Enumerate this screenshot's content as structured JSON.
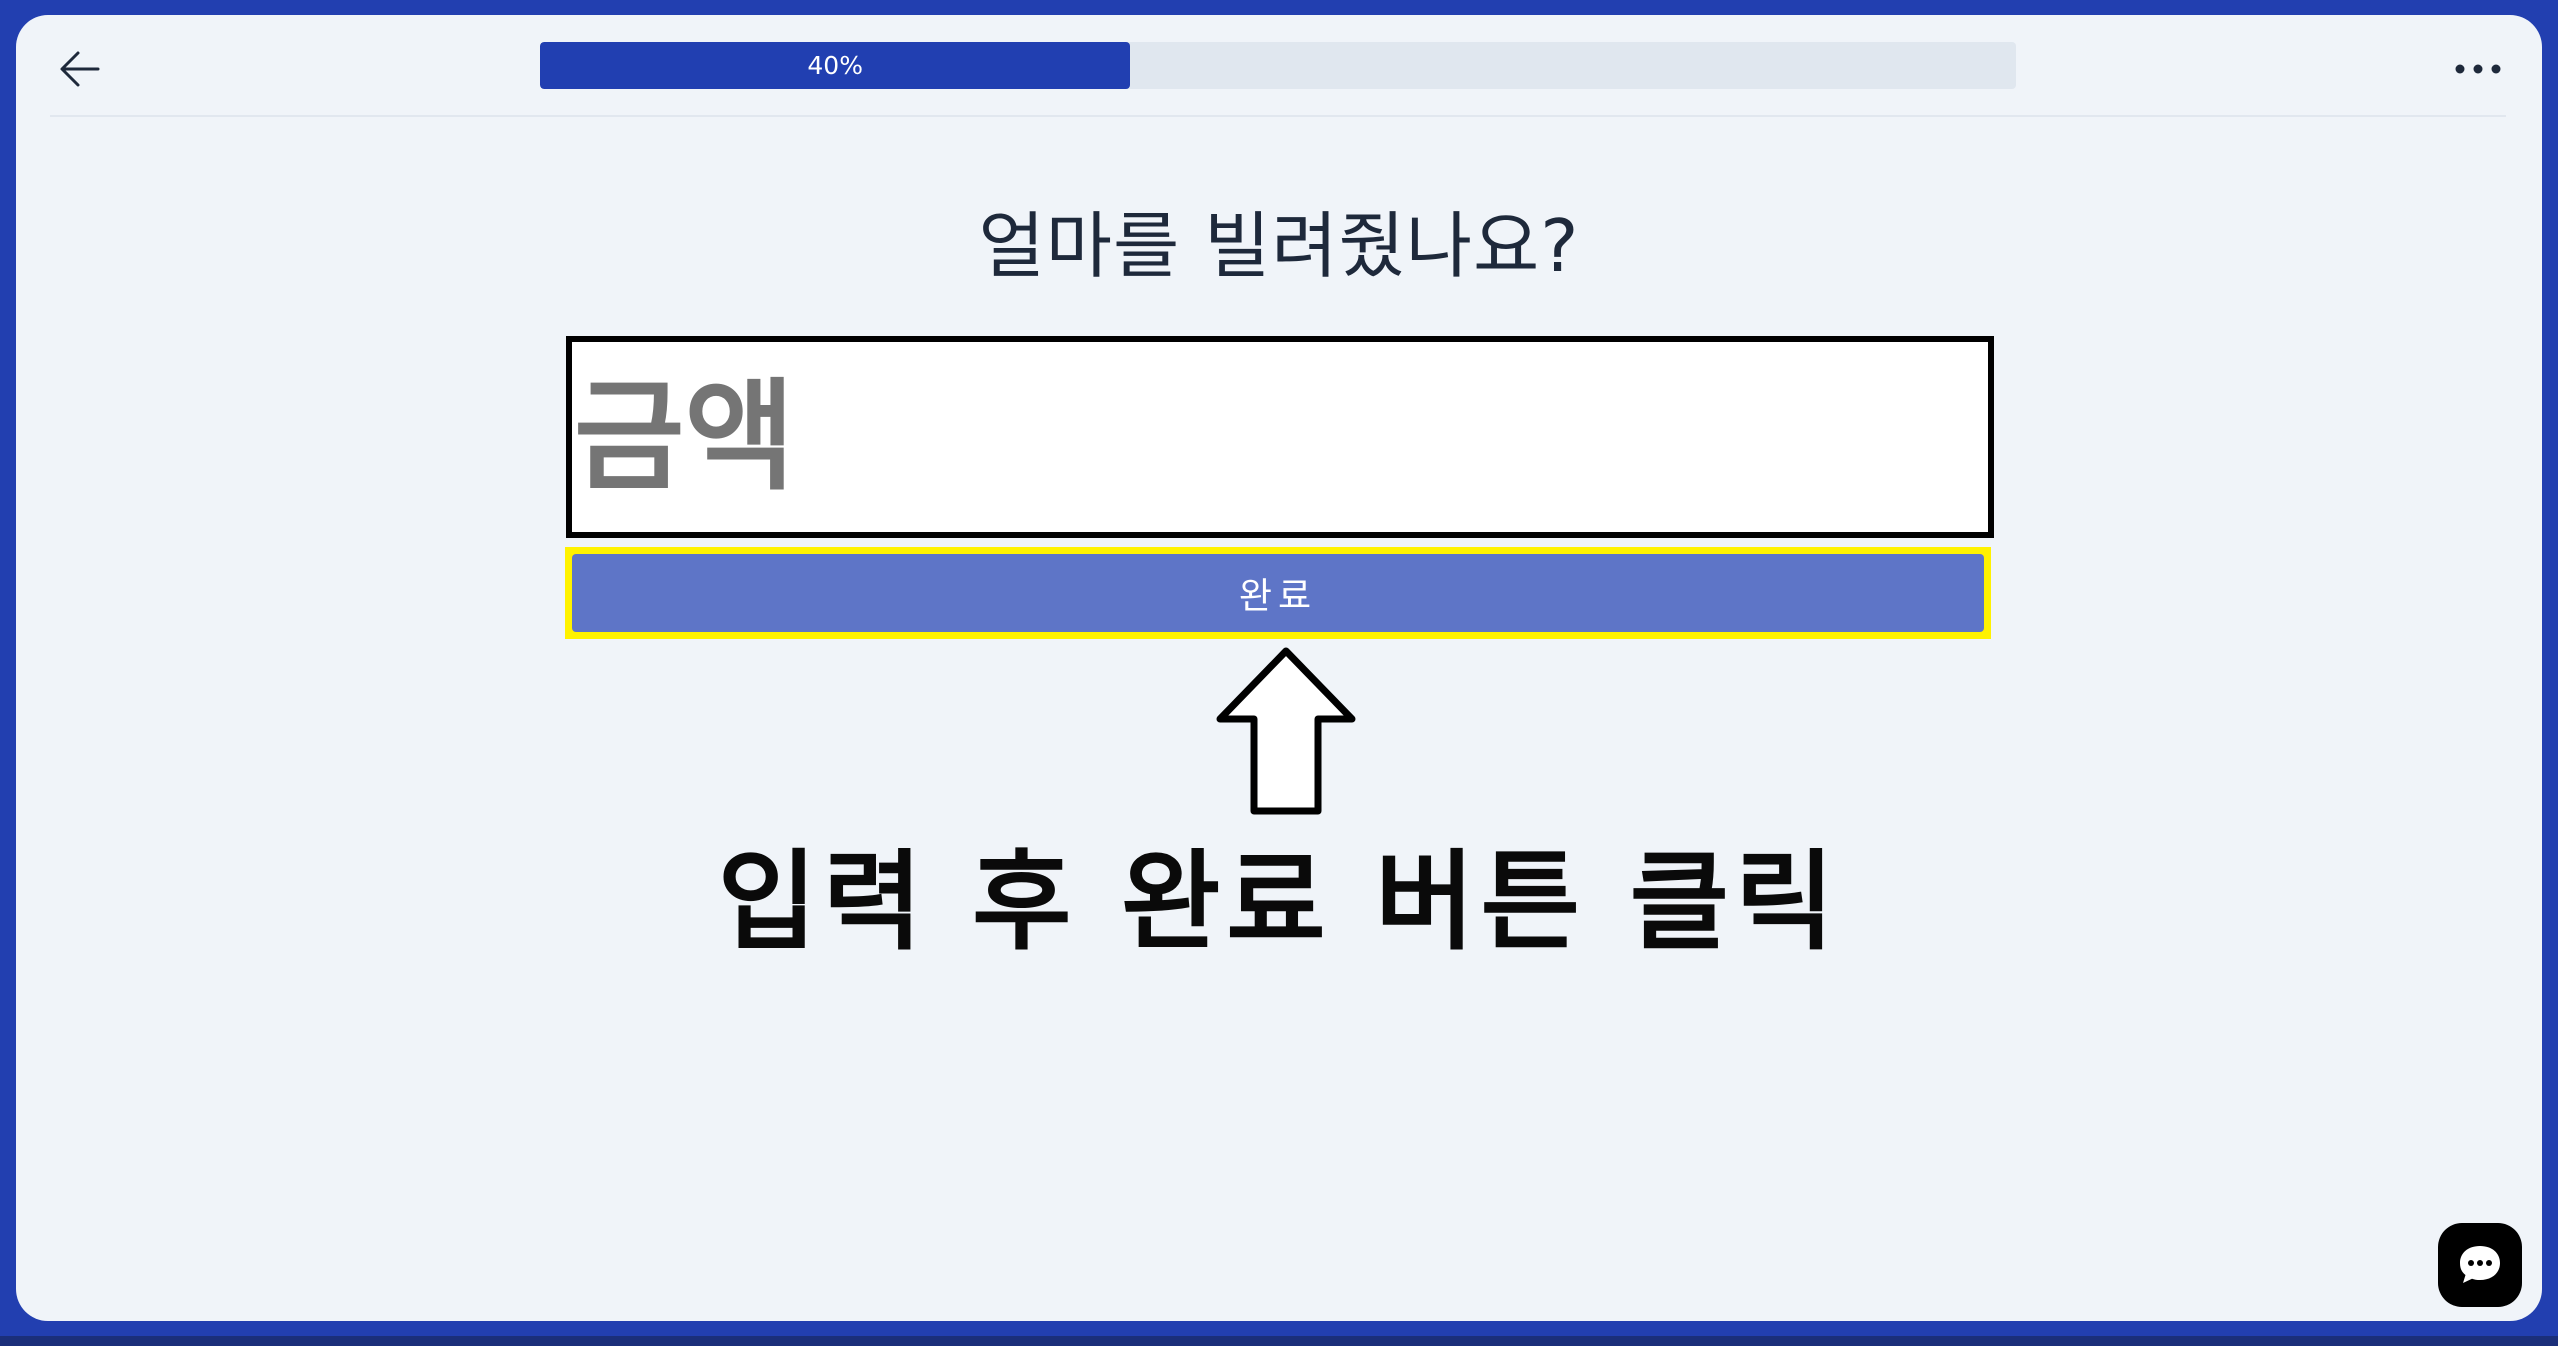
{
  "header": {
    "back_icon": "arrow-left-icon",
    "more_icon": "more-horizontal-icon",
    "progress": {
      "percent": 40,
      "label": "40%",
      "fill_color": "#213fb1",
      "track_color": "#e0e7ef"
    }
  },
  "main": {
    "question": "얼마를 빌려줬나요?",
    "amount_placeholder": "금액",
    "complete_button_label": "완료",
    "instruction": "입력 후 완료 버튼 클릭",
    "arrow_icon": "arrow-up-outline-icon"
  },
  "chat": {
    "icon": "chat-bubble-icon"
  },
  "colors": {
    "frame": "#223fb0",
    "panel": "#f0f4f9",
    "button": "#5e75c7",
    "highlight": "#fff200"
  }
}
